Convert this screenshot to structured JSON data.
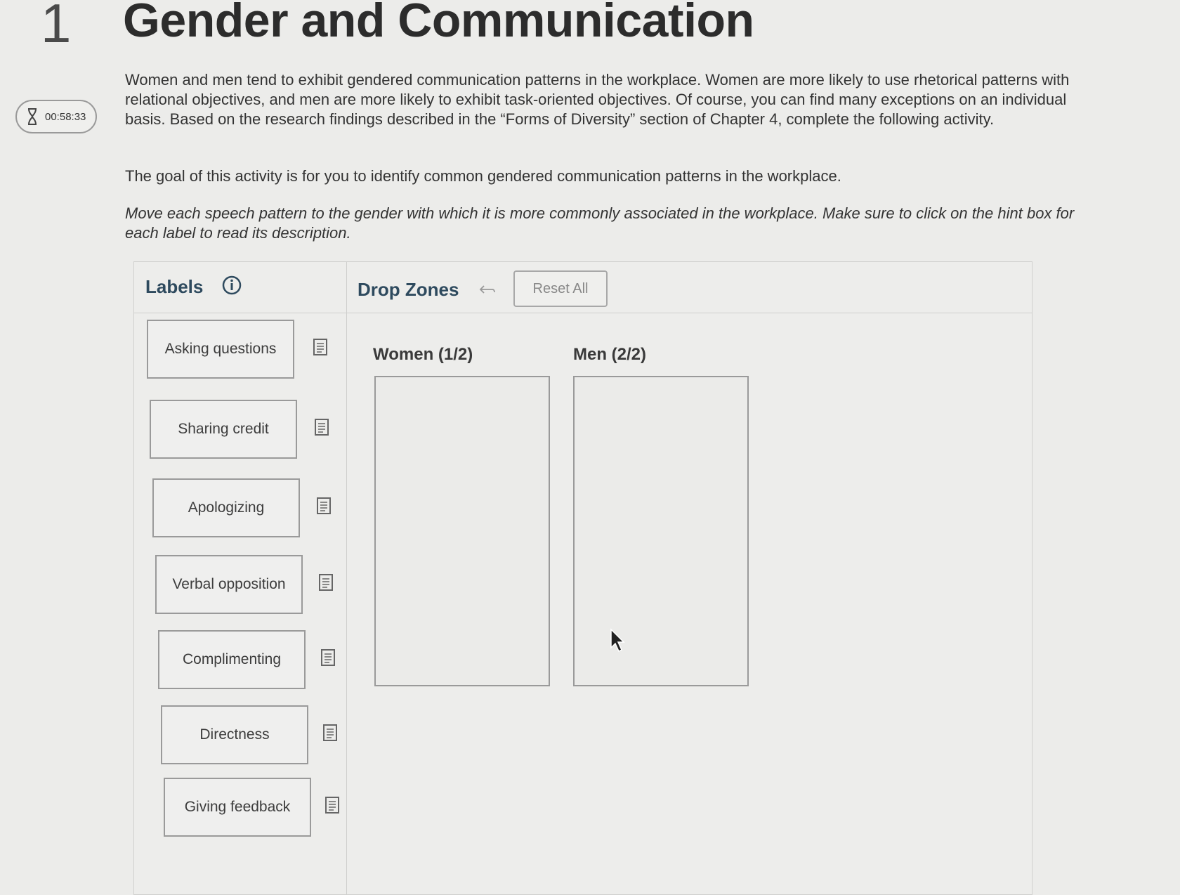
{
  "question": {
    "number": "1",
    "title": "Gender and Communication"
  },
  "timer": {
    "icon": "hourglass-icon",
    "value": "00:58:33"
  },
  "instructions": {
    "paragraph1": "Women and men tend to exhibit gendered communication patterns in the workplace. Women are more likely to use rhetorical patterns with relational objectives, and men are more likely to exhibit task-oriented objectives. Of course, you can find many exceptions on an individual basis. Based on the research findings described in the “Forms of Diversity” section of Chapter 4, complete the following activity.",
    "paragraph2": "The goal of this activity is for you to identify common gendered communication patterns in the workplace.",
    "paragraph3": "Move each speech pattern to the gender with which it is more commonly associated in the workplace. Make sure to click on the hint box for each label to read its description."
  },
  "labels_panel": {
    "title": "Labels",
    "info_icon": "info-icon",
    "items": [
      {
        "label": "Asking questions",
        "hint_icon": "hint-icon"
      },
      {
        "label": "Sharing credit",
        "hint_icon": "hint-icon"
      },
      {
        "label": "Apologizing",
        "hint_icon": "hint-icon"
      },
      {
        "label": "Verbal opposition",
        "hint_icon": "hint-icon"
      },
      {
        "label": "Complimenting",
        "hint_icon": "hint-icon"
      },
      {
        "label": "Directness",
        "hint_icon": "hint-icon"
      },
      {
        "label": "Giving feedback",
        "hint_icon": "hint-icon"
      }
    ]
  },
  "drop_zones_panel": {
    "title": "Drop Zones",
    "undo_icon": "undo-icon",
    "reset_label": "Reset All",
    "zones": [
      {
        "label": "Women (1/2)"
      },
      {
        "label": "Men (2/2)"
      }
    ]
  },
  "colors": {
    "accent": "#2e4a5e",
    "background": "#ececea",
    "border": "#9a9a9a"
  }
}
